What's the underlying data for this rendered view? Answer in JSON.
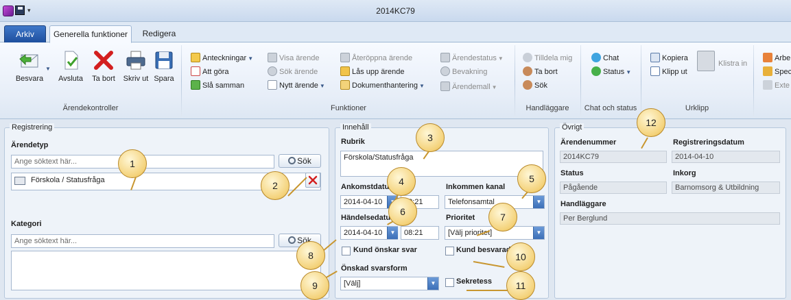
{
  "window": {
    "title": "2014KC79"
  },
  "tabs": {
    "arkiv": "Arkiv",
    "general": "Generella funktioner",
    "edit": "Redigera"
  },
  "ribbon": {
    "arendekontroller": {
      "label": "Ärendekontroller",
      "besvara": "Besvara",
      "avsluta": "Avsluta",
      "ta_bort": "Ta bort",
      "skriv_ut": "Skriv ut",
      "spara": "Spara"
    },
    "funktioner": {
      "label": "Funktioner",
      "anteckningar": "Anteckningar",
      "att_gora": "Att göra",
      "sla_samman": "Slå samman",
      "visa_arende": "Visa ärende",
      "sok_arende": "Sök ärende",
      "nytt_arende": "Nytt ärende",
      "ateroppna": "Återöppna ärende",
      "las_upp": "Lås upp ärende",
      "dokumenthantering": "Dokumenthantering",
      "arendestatus": "Ärendestatus",
      "bevakning": "Bevakning",
      "arendemall": "Ärendemall"
    },
    "handlaggare": {
      "label": "Handläggare",
      "tilldela": "Tilldela mig",
      "ta_bort": "Ta bort",
      "sok": "Sök"
    },
    "chat": {
      "label": "Chat och status",
      "chat": "Chat",
      "status": "Status"
    },
    "urklipp": {
      "label": "Urklipp",
      "kopiera": "Kopiera",
      "klipp_ut": "Klipp ut",
      "klistra_in": "Klistra in"
    },
    "extra": {
      "arbe": "Arbe",
      "spec": "Spec",
      "exte": "Exte"
    }
  },
  "registrering": {
    "title": "Registrering",
    "arendetyp_label": "Ärendetyp",
    "arendetyp_placeholder": "Ange söktext här...",
    "sok": "Sök",
    "selected_type": "Förskola / Statusfråga",
    "kategori_label": "Kategori",
    "kategori_placeholder": "Ange söktext här..."
  },
  "innehall": {
    "title": "Innehåll",
    "rubrik_label": "Rubrik",
    "rubrik_value": "Förskola/Statusfråga",
    "ankomst_label": "Ankomstdatum",
    "ankomst_date": "2014-04-10",
    "ankomst_time": "08:21",
    "kanal_label": "Inkommen kanal",
    "kanal_value": "Telefonsamtal",
    "handelse_label": "Händelsedatum",
    "handelse_date": "2014-04-10",
    "handelse_time": "08:21",
    "prioritet_label": "Prioritet",
    "prioritet_value": "[Välj prioritet]",
    "kund_onskar_svar": "Kund önskar svar",
    "kund_besvarad": "Kund besvarad",
    "svarsform_label": "Önskad svarsform",
    "svarsform_value": "[Välj]",
    "sekretess": "Sekretess"
  },
  "ovrigt": {
    "title": "Övrigt",
    "arendenummer_label": "Ärendenummer",
    "arendenummer_value": "2014KC79",
    "regdatum_label": "Registreringsdatum",
    "regdatum_value": "2014-04-10",
    "status_label": "Status",
    "status_value": "Pågående",
    "inkorg_label": "Inkorg",
    "inkorg_value": "Barnomsorg & Utbildning",
    "handlaggare_label": "Handläggare",
    "handlaggare_value": "Per Berglund"
  },
  "callouts": [
    "1",
    "2",
    "3",
    "4",
    "5",
    "6",
    "7",
    "8",
    "9",
    "10",
    "11",
    "12"
  ]
}
